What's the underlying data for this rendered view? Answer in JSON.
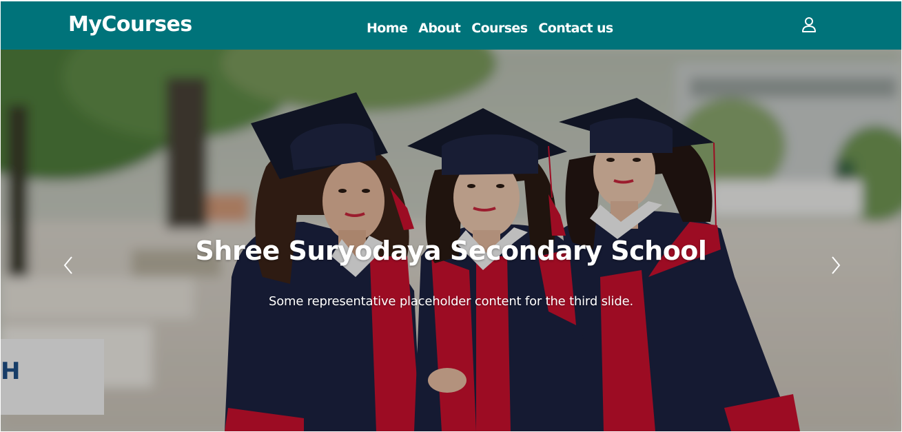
{
  "navbar": {
    "brand": "MyCourses",
    "links": [
      {
        "label": "Home"
      },
      {
        "label": "About"
      },
      {
        "label": "Courses"
      },
      {
        "label": "Contact us"
      }
    ],
    "user_icon": "user-icon",
    "background_color": "#00737a"
  },
  "carousel": {
    "active_slide": {
      "title": "Shree Suryodaya Secondary School",
      "text": "Some representative placeholder content for the third slide.",
      "image": "three graduates in caps and gowns"
    },
    "controls": {
      "prev_icon": "chevron-left-icon",
      "next_icon": "chevron-right-icon"
    }
  },
  "colors": {
    "accent": "#00737a",
    "gown_navy": "#1c2240",
    "gown_red": "#c8102e"
  }
}
